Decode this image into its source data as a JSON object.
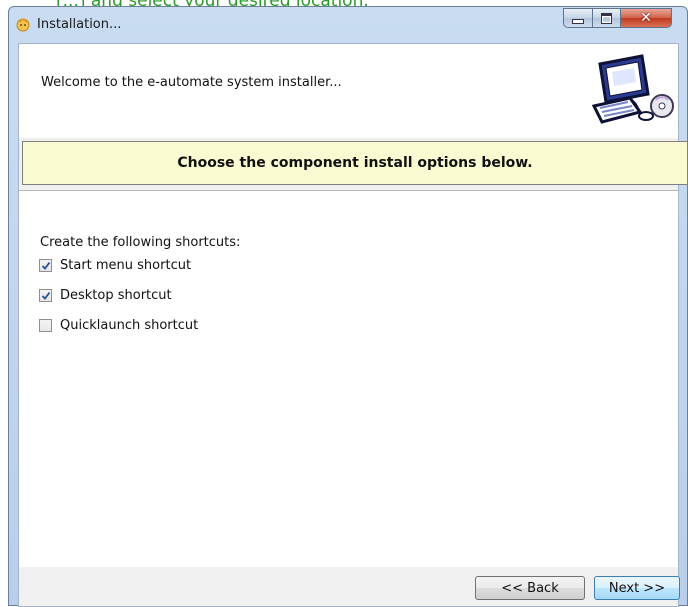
{
  "doc_text": "[...] and select your desired location.",
  "window": {
    "title": "Installation...",
    "controls": {
      "close_glyph": "✕"
    }
  },
  "header": {
    "welcome": "Welcome to the e-automate system installer..."
  },
  "banner": {
    "text": "Choose the component install options below."
  },
  "shortcuts": {
    "label": "Create the following shortcuts:",
    "options": [
      {
        "label": "Start menu shortcut",
        "checked": true
      },
      {
        "label": "Desktop shortcut",
        "checked": true
      },
      {
        "label": "Quicklaunch shortcut",
        "checked": false
      }
    ]
  },
  "buttons": {
    "back": "<< Back",
    "next": "Next >>"
  },
  "colors": {
    "banner_bg": "#fafad2",
    "titlebar": "#c9dcf1",
    "close_button": "#c0391c",
    "doc_text": "#2a9a2a"
  },
  "icons": {
    "app": "installer-app-icon",
    "header": "computer-with-cd-icon"
  }
}
